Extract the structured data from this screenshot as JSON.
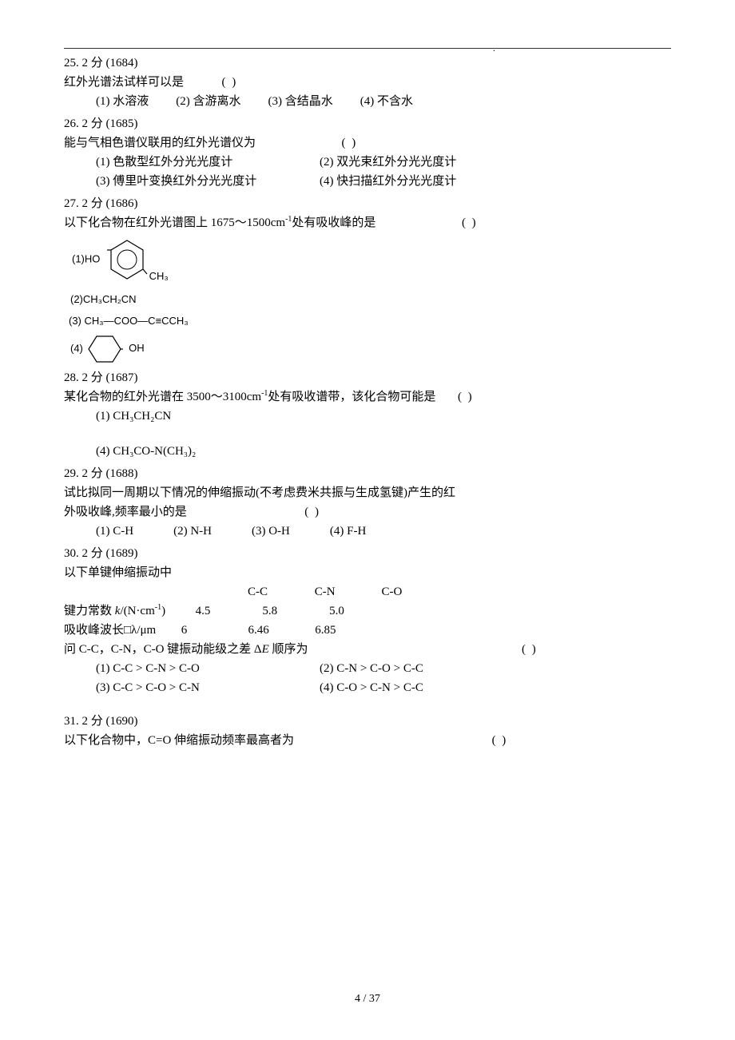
{
  "top_dot": ".",
  "q25": {
    "header": "25.  2 分 (1684)",
    "stem": "红外光谱法试样可以是",
    "paren": "(         )",
    "opt1": "(1) 水溶液",
    "opt2": "(2) 含游离水",
    "opt3": "(3) 含结晶水",
    "opt4": "(4) 不含水"
  },
  "q26": {
    "header": "26.  2 分 (1685)",
    "stem": "能与气相色谱仪联用的红外光谱仪为",
    "paren": "(         )",
    "opt1": "(1) 色散型红外分光光度计",
    "opt2": "(2) 双光束红外分光光度计",
    "opt3": "(3) 傅里叶变换红外分光光度计",
    "opt4": "(4) 快扫描红外分光光度计"
  },
  "q27": {
    "header": "27.  2 分 (1686)",
    "stem_pre": "以下化合物在红外光谱图上 1675～1500cm",
    "stem_post": "处有吸收峰的是",
    "sup": "-1",
    "paren": "(         )",
    "opt1_label": "(1)",
    "opt1_left": "HO",
    "opt1_right": "CH₃",
    "opt2": "(2)CH₃CH₂CN",
    "opt3": "(3) CH₃—COO—C≡CCH₃",
    "opt4_label": "(4)",
    "opt4_right": "OH"
  },
  "q28": {
    "header": "28.  2 分 (1687)",
    "stem_pre": "某化合物的红外光谱在 3500～3100cm",
    "sup": "-1",
    "stem_post": "处有吸收谱带，该化合物可能是",
    "paren": "(         )",
    "opt1": "(1) CH₃CH₂CN",
    "opt4": "(4) CH₃CO-N(CH₃)₂"
  },
  "q29": {
    "header": "29.  2 分 (1688)",
    "stem1": "试比拟同一周期以下情况的伸缩振动(不考虑费米共振与生成氢键)产生的红",
    "stem2": "外吸收峰,频率最小的是",
    "paren": "(         )",
    "opt1": "(1) C-H",
    "opt2": "(2) N-H",
    "opt3": "(3) O-H",
    "opt4": "(4) F-H"
  },
  "q30": {
    "header": "30.  2 分 (1689)",
    "stem": "以下单键伸缩振动中",
    "col1": "C-C",
    "col2": "C-N",
    "col3": "C-O",
    "row1_label_pre": "键力常数 ",
    "row1_label_k": "k",
    "row1_label_post": "/(N·cm",
    "row1_label_sup": "-1",
    "row1_label_close": ")",
    "row1_v1": "4.5",
    "row1_v2": "5.8",
    "row1_v3": "5.0",
    "row2_label": "吸收峰波长□λ/μm",
    "row2_v1": "6",
    "row2_v2": "6.46",
    "row2_v3": "6.85",
    "ask_pre": "问 C-C，C-N，C-O 键振动能级之差 Δ",
    "ask_E": "E",
    "ask_post": " 顺序为",
    "paren": "(         )",
    "opt1": "(1) C-C > C-N > C-O",
    "opt2": "(2) C-N > C-O > C-C",
    "opt3": "(3) C-C > C-O > C-N",
    "opt4": "(4) C-O > C-N > C-C"
  },
  "q31": {
    "header": "31.  2 分 (1690)",
    "stem": "以下化合物中，C=O 伸缩振动频率最高者为",
    "paren": "(         )"
  },
  "footer": "4 / 37"
}
